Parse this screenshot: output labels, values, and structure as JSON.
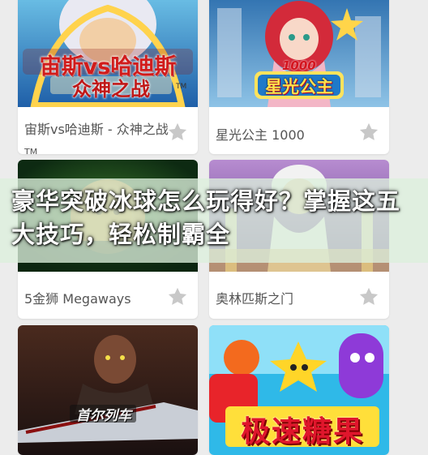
{
  "games": [
    {
      "title_line1": "宙斯vs哈迪斯 - 众神之战",
      "title_line2": "TM",
      "art_text_top": "宙斯vs哈迪斯",
      "art_text_bottom": "众神之战",
      "art_tm": "TM"
    },
    {
      "title": "星光公主 1000",
      "art_text": "星光公主",
      "art_number": "1000"
    },
    {
      "title": "5金狮 Megaways"
    },
    {
      "title": "奥林匹斯之门"
    },
    {
      "title": "",
      "art_text": "首尔列车"
    },
    {
      "title": "",
      "art_text": "极速糖果"
    }
  ],
  "banner": {
    "text": "豪华突破冰球怎么玩得好？掌握这五大技巧，轻松制霸全"
  },
  "icons": {
    "favorite": "star-icon"
  },
  "colors": {
    "star": "#c8c8c8",
    "title": "#555555",
    "banner_bg": "#dcf0dc"
  }
}
